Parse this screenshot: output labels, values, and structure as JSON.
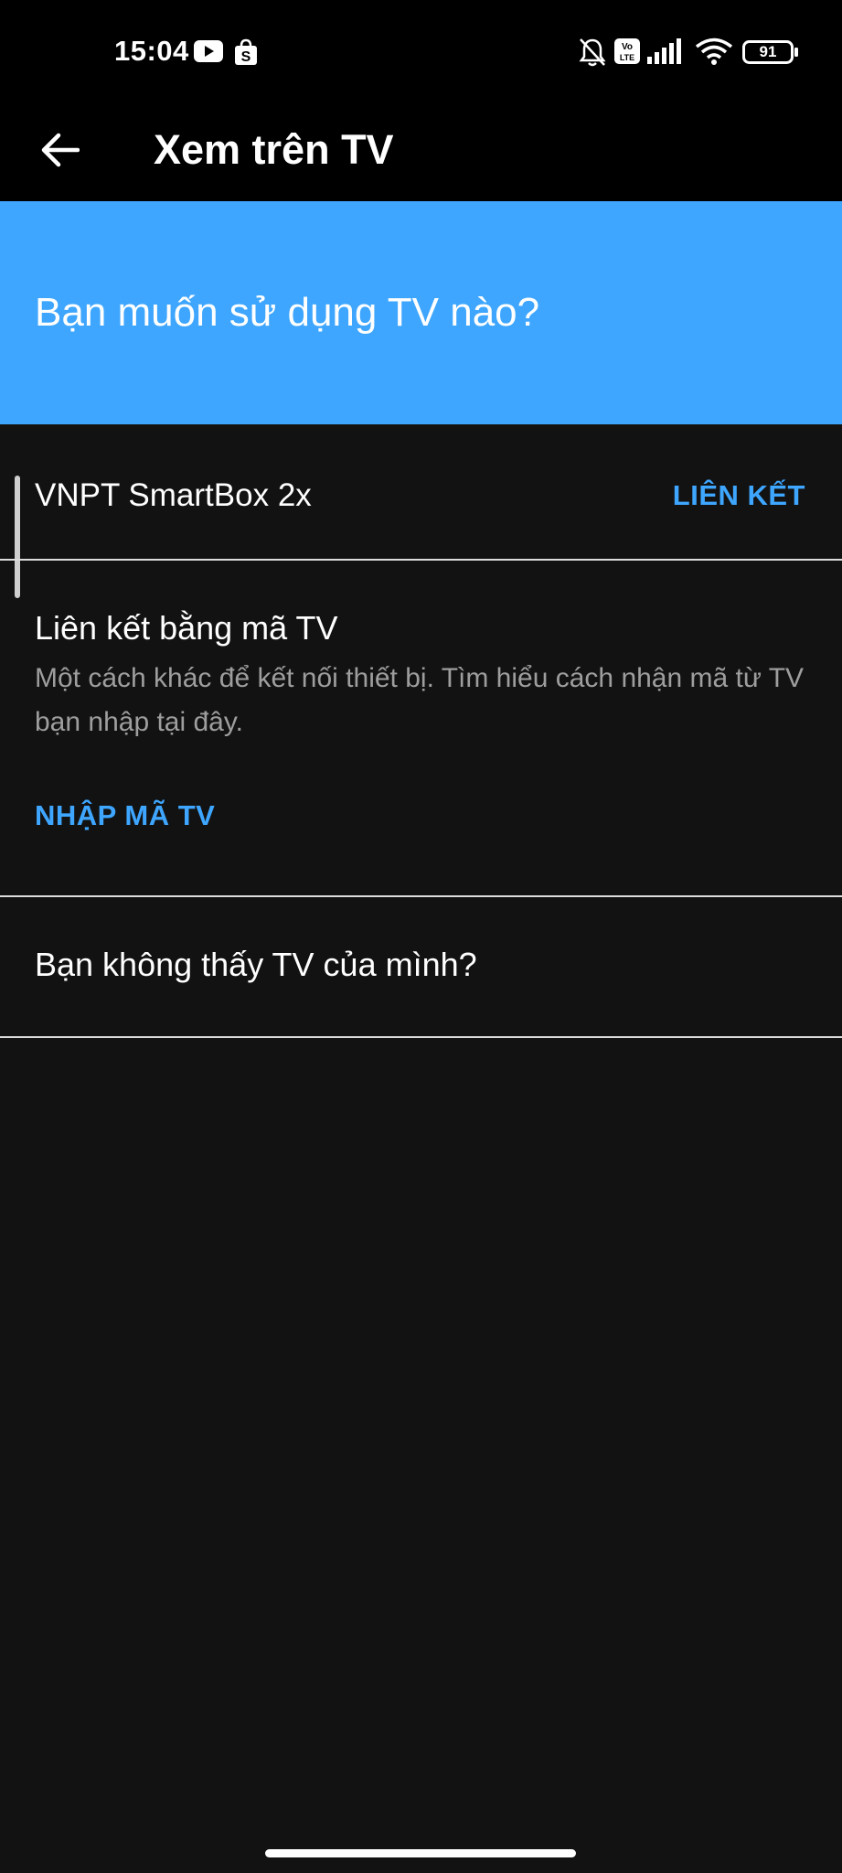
{
  "status_bar": {
    "time": "15:04",
    "battery": "91",
    "volte": "Vo LTE",
    "icons": [
      "youtube-icon",
      "shopee-icon",
      "bell-off-icon",
      "volte-icon",
      "signal-icon",
      "wifi-icon",
      "battery-icon"
    ]
  },
  "app_bar": {
    "title": "Xem trên TV",
    "back_icon": "arrow-left-icon"
  },
  "hero": {
    "title": "Bạn muốn sử dụng TV nào?",
    "background": "#3ea6ff"
  },
  "devices": [
    {
      "name": "VNPT SmartBox 2x",
      "action": "LIÊN KẾT"
    }
  ],
  "tv_code": {
    "title": "Liên kết bằng mã TV",
    "description": "Một cách khác để kết nối thiết bị. Tìm hiểu cách nhận mã từ TV bạn nhập tại đây.",
    "button": "NHẬP MÃ TV"
  },
  "help": {
    "text": "Bạn không thấy TV của mình?"
  },
  "colors": {
    "accent": "#3ea6ff",
    "background": "#121212",
    "secondary_text": "#9e9e9e"
  }
}
